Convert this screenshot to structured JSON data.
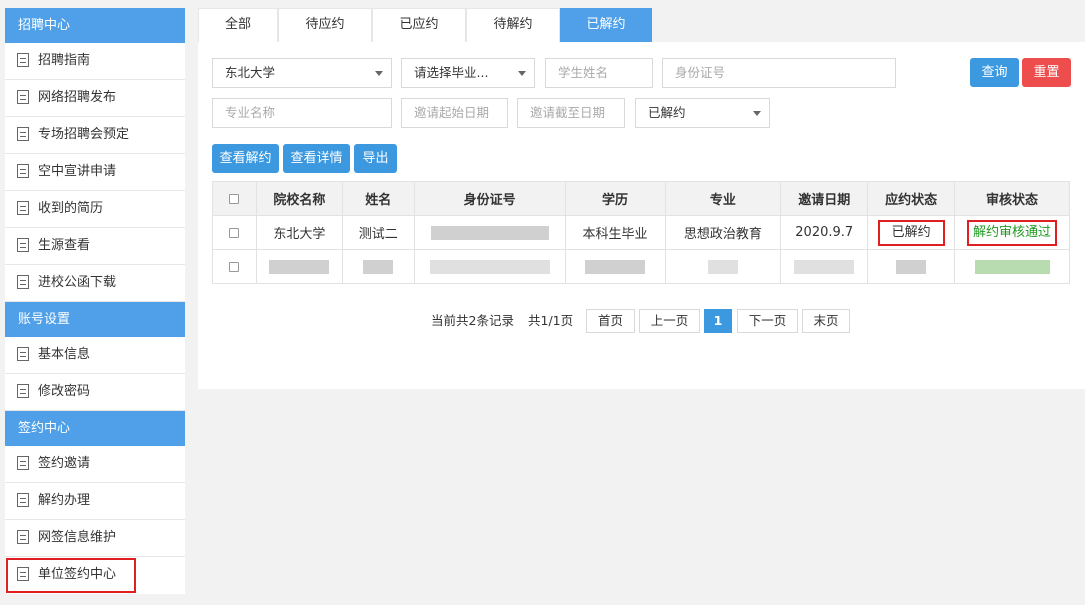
{
  "sidebar": {
    "sections": [
      {
        "title": "招聘中心",
        "items": [
          "招聘指南",
          "网络招聘发布",
          "专场招聘会预定",
          "空中宣讲申请",
          "收到的简历",
          "生源查看",
          "进校公函下载"
        ]
      },
      {
        "title": "账号设置",
        "items": [
          "基本信息",
          "修改密码"
        ]
      },
      {
        "title": "签约中心",
        "items": [
          "签约邀请",
          "解约办理",
          "网签信息维护",
          "单位签约中心"
        ]
      }
    ]
  },
  "tabs": [
    "全部",
    "待应约",
    "已应约",
    "待解约",
    "已解约"
  ],
  "active_tab": "已解约",
  "filters": {
    "school": "东北大学",
    "graduate_type": "请选择毕业...",
    "student_name_placeholder": "学生姓名",
    "id_number_placeholder": "身份证号",
    "major_placeholder": "专业名称",
    "start_date_placeholder": "邀请起始日期",
    "end_date_placeholder": "邀请截至日期",
    "status": "已解约"
  },
  "buttons": {
    "query": "查询",
    "reset": "重置",
    "view_cancel": "查看解约",
    "view_detail": "查看详情",
    "export": "导出"
  },
  "table": {
    "headers": [
      "院校名称",
      "姓名",
      "身份证号",
      "学历",
      "专业",
      "邀请日期",
      "应约状态",
      "审核状态"
    ],
    "rows": [
      {
        "school": "东北大学",
        "name": "测试二",
        "id_number": "",
        "education": "本科生毕业",
        "major": "思想政治教育",
        "invite_date": "2020.9.7",
        "status": "已解约",
        "audit": "解约审核通过"
      }
    ]
  },
  "pagination": {
    "summary": "当前共2条记录",
    "pages": "共1/1页",
    "first": "首页",
    "prev": "上一页",
    "current": "1",
    "next": "下一页",
    "last": "末页"
  },
  "colors": {
    "accent": "#4fa0e8",
    "danger": "#ee4d4d",
    "success_text": "#1f9a1f",
    "highlight_border": "#e02020"
  }
}
